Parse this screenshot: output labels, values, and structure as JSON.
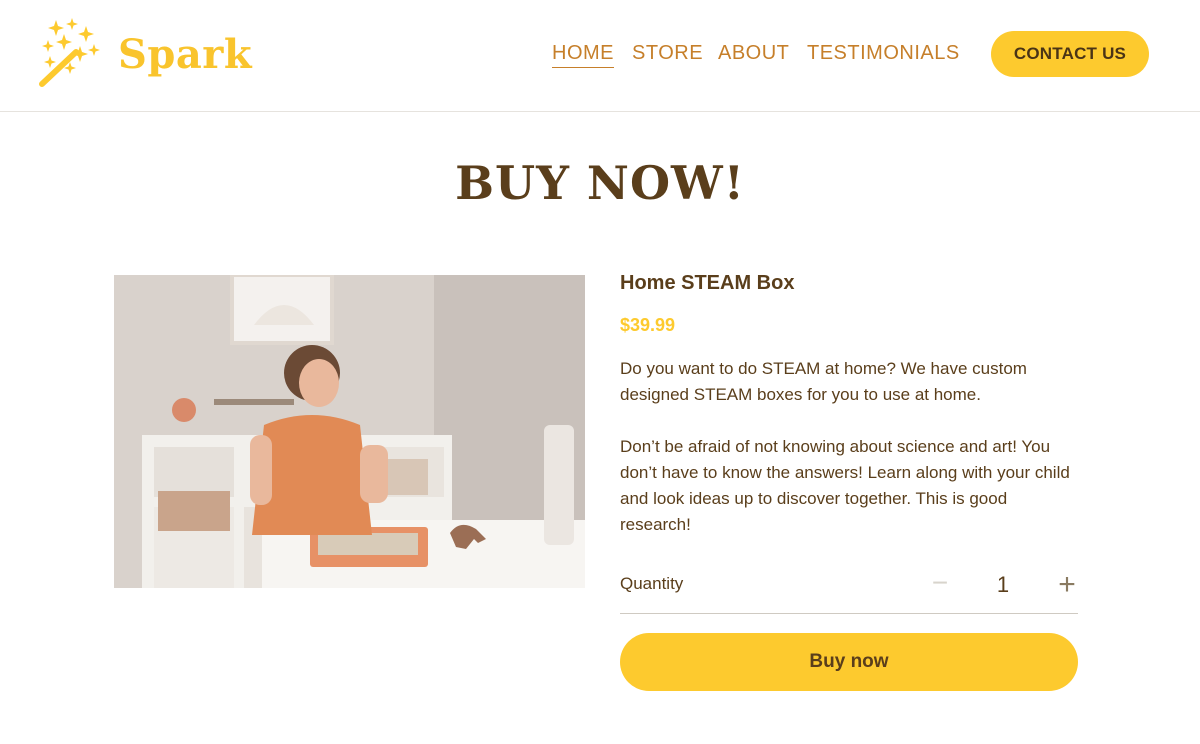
{
  "brand": {
    "name": "Spark",
    "logo_icon": "magic-wand-sparkles-icon",
    "color": "#fdca2e"
  },
  "nav": {
    "items": [
      {
        "label": "HOME",
        "active": true
      },
      {
        "label": "STORE",
        "active": false
      },
      {
        "label": "ABOUT",
        "active": false
      },
      {
        "label": "TESTIMONIALS",
        "active": false
      }
    ],
    "contact_label": "CONTACT US"
  },
  "page": {
    "title": "BUY NOW!"
  },
  "product": {
    "name": "Home STEAM Box",
    "price": "$39.99",
    "description": [
      "Do you want to do STEAM at home? We have custom designed STEAM boxes for you to use at home.",
      "Don’t be afraid of not knowing about science and art! You don’t have to know the answers! Learn along with your child and look ideas up to discover together. This is good research!"
    ],
    "image_icon": "child-playing-photo"
  },
  "quantity": {
    "label": "Quantity",
    "value": "1",
    "minus_icon": "minus-icon",
    "plus_icon": "plus-icon"
  },
  "buy_button": {
    "label": "Buy now"
  },
  "colors": {
    "accent": "#fdca2e",
    "text": "#5a3e1b",
    "nav": "#c67f2a"
  }
}
